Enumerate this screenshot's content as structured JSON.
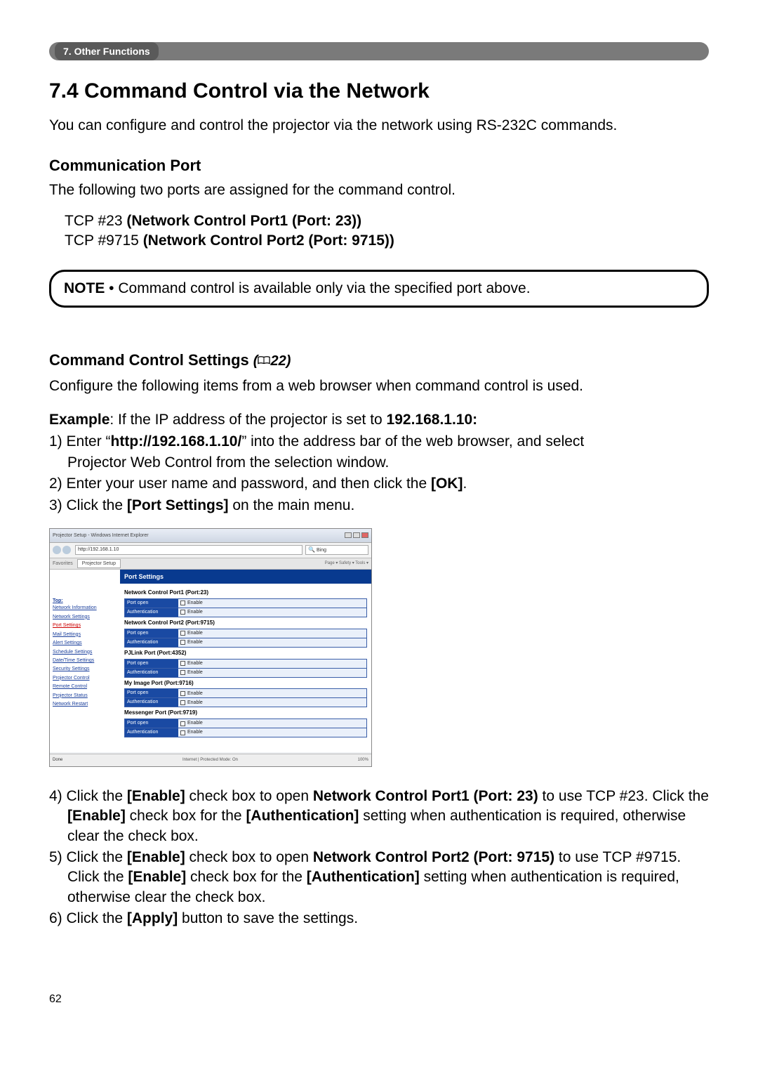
{
  "chapter_bar": {
    "label": "7. Other Functions"
  },
  "section": {
    "number_title": "7.4 Command Control via the Network",
    "intro": "You can configure and control the projector via the network using RS-232C commands."
  },
  "comm_port": {
    "heading": "Communication Port",
    "lead": "The following two ports are assigned for the command control.",
    "lines": [
      {
        "prefix": "TCP #23 ",
        "bold": "(Network Control Port1 (Port: 23))"
      },
      {
        "prefix": "TCP #9715 ",
        "bold": "(Network Control Port2 (Port: 9715))"
      }
    ]
  },
  "note": {
    "label": "NOTE",
    "bullet": " • ",
    "text": "Command control is available only via the specified port above."
  },
  "ccs": {
    "heading": "Command Control Settings",
    "ref_open": "(",
    "ref_page": "22",
    "ref_close": ")",
    "lead": "Configure the following items from a web browser when command control is used.",
    "example_label": "Example",
    "example_rest": ": If the IP address of the projector is set to ",
    "example_ip": "192.168.1.10:",
    "steps": [
      {
        "n": "1) ",
        "pre": "Enter “",
        "b1": "http://192.168.1.10/",
        "post1": "” into the address bar of the web browser, and select ",
        "cont": "Projector Web Control from the selection window."
      },
      {
        "n": "2) ",
        "pre": "Enter your user name and password, and then click the ",
        "b1": "[OK]",
        "post1": "."
      },
      {
        "n": "3) ",
        "pre": "Click the ",
        "b1": "[Port Settings]",
        "post1": " on the main menu."
      }
    ],
    "steps_after": [
      {
        "n": "4) ",
        "parts": [
          "Click the ",
          "[Enable]",
          " check box to open ",
          "Network Control Port1 (Port: 23)",
          " to use TCP #23. Click the ",
          "[Enable]",
          " check box for the ",
          "[Authentication]",
          " setting when authentication is required, otherwise clear the check box."
        ]
      },
      {
        "n": "5) ",
        "parts": [
          "Click the ",
          "[Enable]",
          " check box to open ",
          "Network Control Port2 (Port: 9715)",
          " to use TCP #9715. Click the ",
          "[Enable]",
          " check box for the ",
          "[Authentication]",
          " setting when authentication is required, otherwise clear the check box."
        ]
      },
      {
        "n": "6) ",
        "parts": [
          "Click the ",
          "[Apply]",
          " button to save the settings."
        ]
      }
    ]
  },
  "screenshot": {
    "window_title": "Projector Setup - Windows Internet Explorer",
    "url": "http://192.168.1.10",
    "search_placeholder": "Bing",
    "fav_label": "Favorites",
    "tab_label": "Projector Setup",
    "tools": "Page ▾  Safety ▾  Tools ▾",
    "status_left": "Done",
    "status_mid": "Internet | Protected Mode: On",
    "status_right": "100%",
    "side_top": "Top:",
    "sidebar": [
      "Network Information",
      "Network Settings",
      "Port Settings",
      "Mail Settings",
      "Alert Settings",
      "Schedule Settings",
      "Date/Time Settings",
      "Security Settings",
      "Projector Control",
      "Remote Control",
      "Projector Status",
      "Network Restart"
    ],
    "panel_title": "Port Settings",
    "groups": [
      {
        "label": "Network Control Port1 (Port:23)",
        "rows": [
          [
            "Port open",
            "Enable"
          ],
          [
            "Authentication",
            "Enable"
          ]
        ]
      },
      {
        "label": "Network Control Port2 (Port:9715)",
        "rows": [
          [
            "Port open",
            "Enable"
          ],
          [
            "Authentication",
            "Enable"
          ]
        ]
      },
      {
        "label": "PJLink Port (Port:4352)",
        "rows": [
          [
            "Port open",
            "Enable"
          ],
          [
            "Authentication",
            "Enable"
          ]
        ]
      },
      {
        "label": "My Image Port (Port:9716)",
        "rows": [
          [
            "Port open",
            "Enable"
          ],
          [
            "Authentication",
            "Enable"
          ]
        ]
      },
      {
        "label": "Messenger Port (Port:9719)",
        "rows": [
          [
            "Port open",
            "Enable"
          ],
          [
            "Authentication",
            "Enable"
          ]
        ]
      }
    ]
  },
  "page_number": "62"
}
